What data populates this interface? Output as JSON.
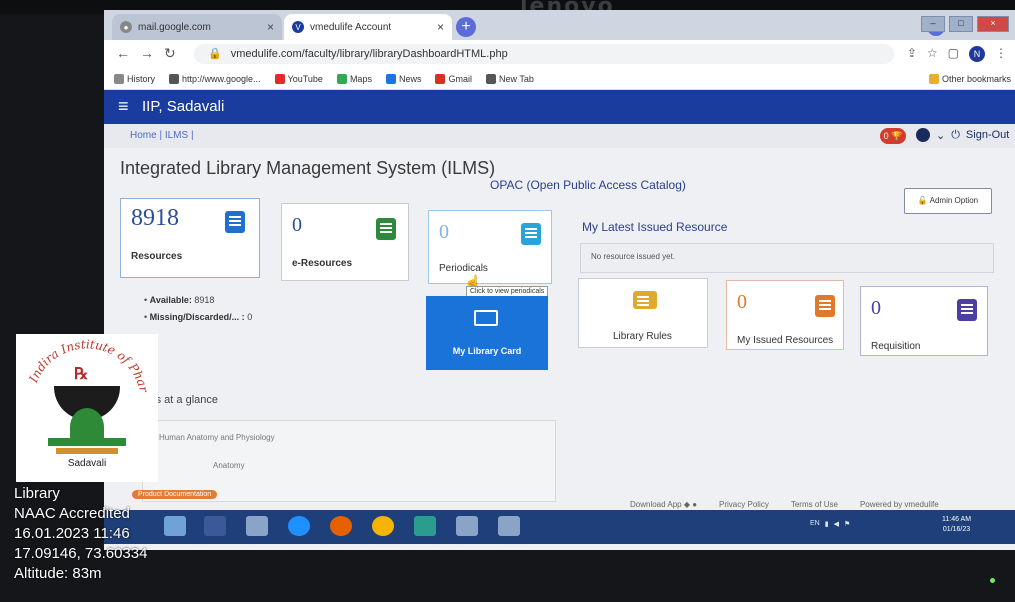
{
  "browser": {
    "tabs": [
      {
        "label": "mail.google.com",
        "active": false
      },
      {
        "label": "vmedulife Account",
        "active": true
      }
    ],
    "url": "vmedulife.com/faculty/library/libraryDashboardHTML.php",
    "bookmarks": [
      "History",
      "http://www.google...",
      "YouTube",
      "Maps",
      "News",
      "Gmail",
      "New Tab"
    ],
    "other_bookmarks": "Other bookmarks",
    "profile_initial": "N"
  },
  "app": {
    "title": "IIP, Sadavali",
    "breadcrumb": "Home | ILMS |",
    "trophy_count": "0",
    "sign_out": "Sign-Out",
    "page_title": "Integrated Library Management System (ILMS)",
    "opac_link": "OPAC (Open Public Access Catalog)",
    "admin_option": "Admin Option"
  },
  "cards": {
    "resources": {
      "count": "8918",
      "label": "Resources",
      "icon_color": "#1f6fd1"
    },
    "e_resources": {
      "count": "0",
      "label": "e-Resources",
      "icon_color": "#2c8a3a"
    },
    "periodicals": {
      "count": "0",
      "label": "Periodicals",
      "icon_color": "#2aa3d8",
      "tooltip": "Click to view periodicals"
    },
    "my_library_card": {
      "label": "My Library Card"
    },
    "library_rules": {
      "label": "Library Rules",
      "icon_color": "#e0a82e"
    },
    "my_issued": {
      "count": "0",
      "label": "My Issued Resources",
      "icon_color": "#e07a2a"
    },
    "requisition": {
      "count": "0",
      "label": "Requisition",
      "icon_color": "#4b3fa3"
    }
  },
  "availability": {
    "available_label": "Available:",
    "available_value": "8918",
    "missing_label": "Missing/Discarded/... :",
    "missing_value": "0"
  },
  "latest": {
    "title": "My Latest Issued Resource",
    "empty": "No resource issued yet."
  },
  "glance": {
    "title": "ces at a glance",
    "item1": "Human Anatomy and Physiology",
    "item2": "Anatomy"
  },
  "footer": {
    "badge": "Product Documentation",
    "download": "Download App",
    "privacy": "Privacy Policy",
    "terms": "Terms of Use",
    "powered": "Powered by vmedulife"
  },
  "taskbar": {
    "lang": "EN",
    "time": "11:46 AM",
    "date": "01/16/23"
  },
  "watermark": {
    "logo_text": "Indira Institute of Pharmacy",
    "logo_sub": "Sadavali",
    "line1": "Library",
    "line2": "NAAC Accredited",
    "line3": "16.01.2023 11:46",
    "line4": "17.09146, 73.60334",
    "line5": "Altitude: 83m"
  },
  "monitor_brand": "lenovo"
}
